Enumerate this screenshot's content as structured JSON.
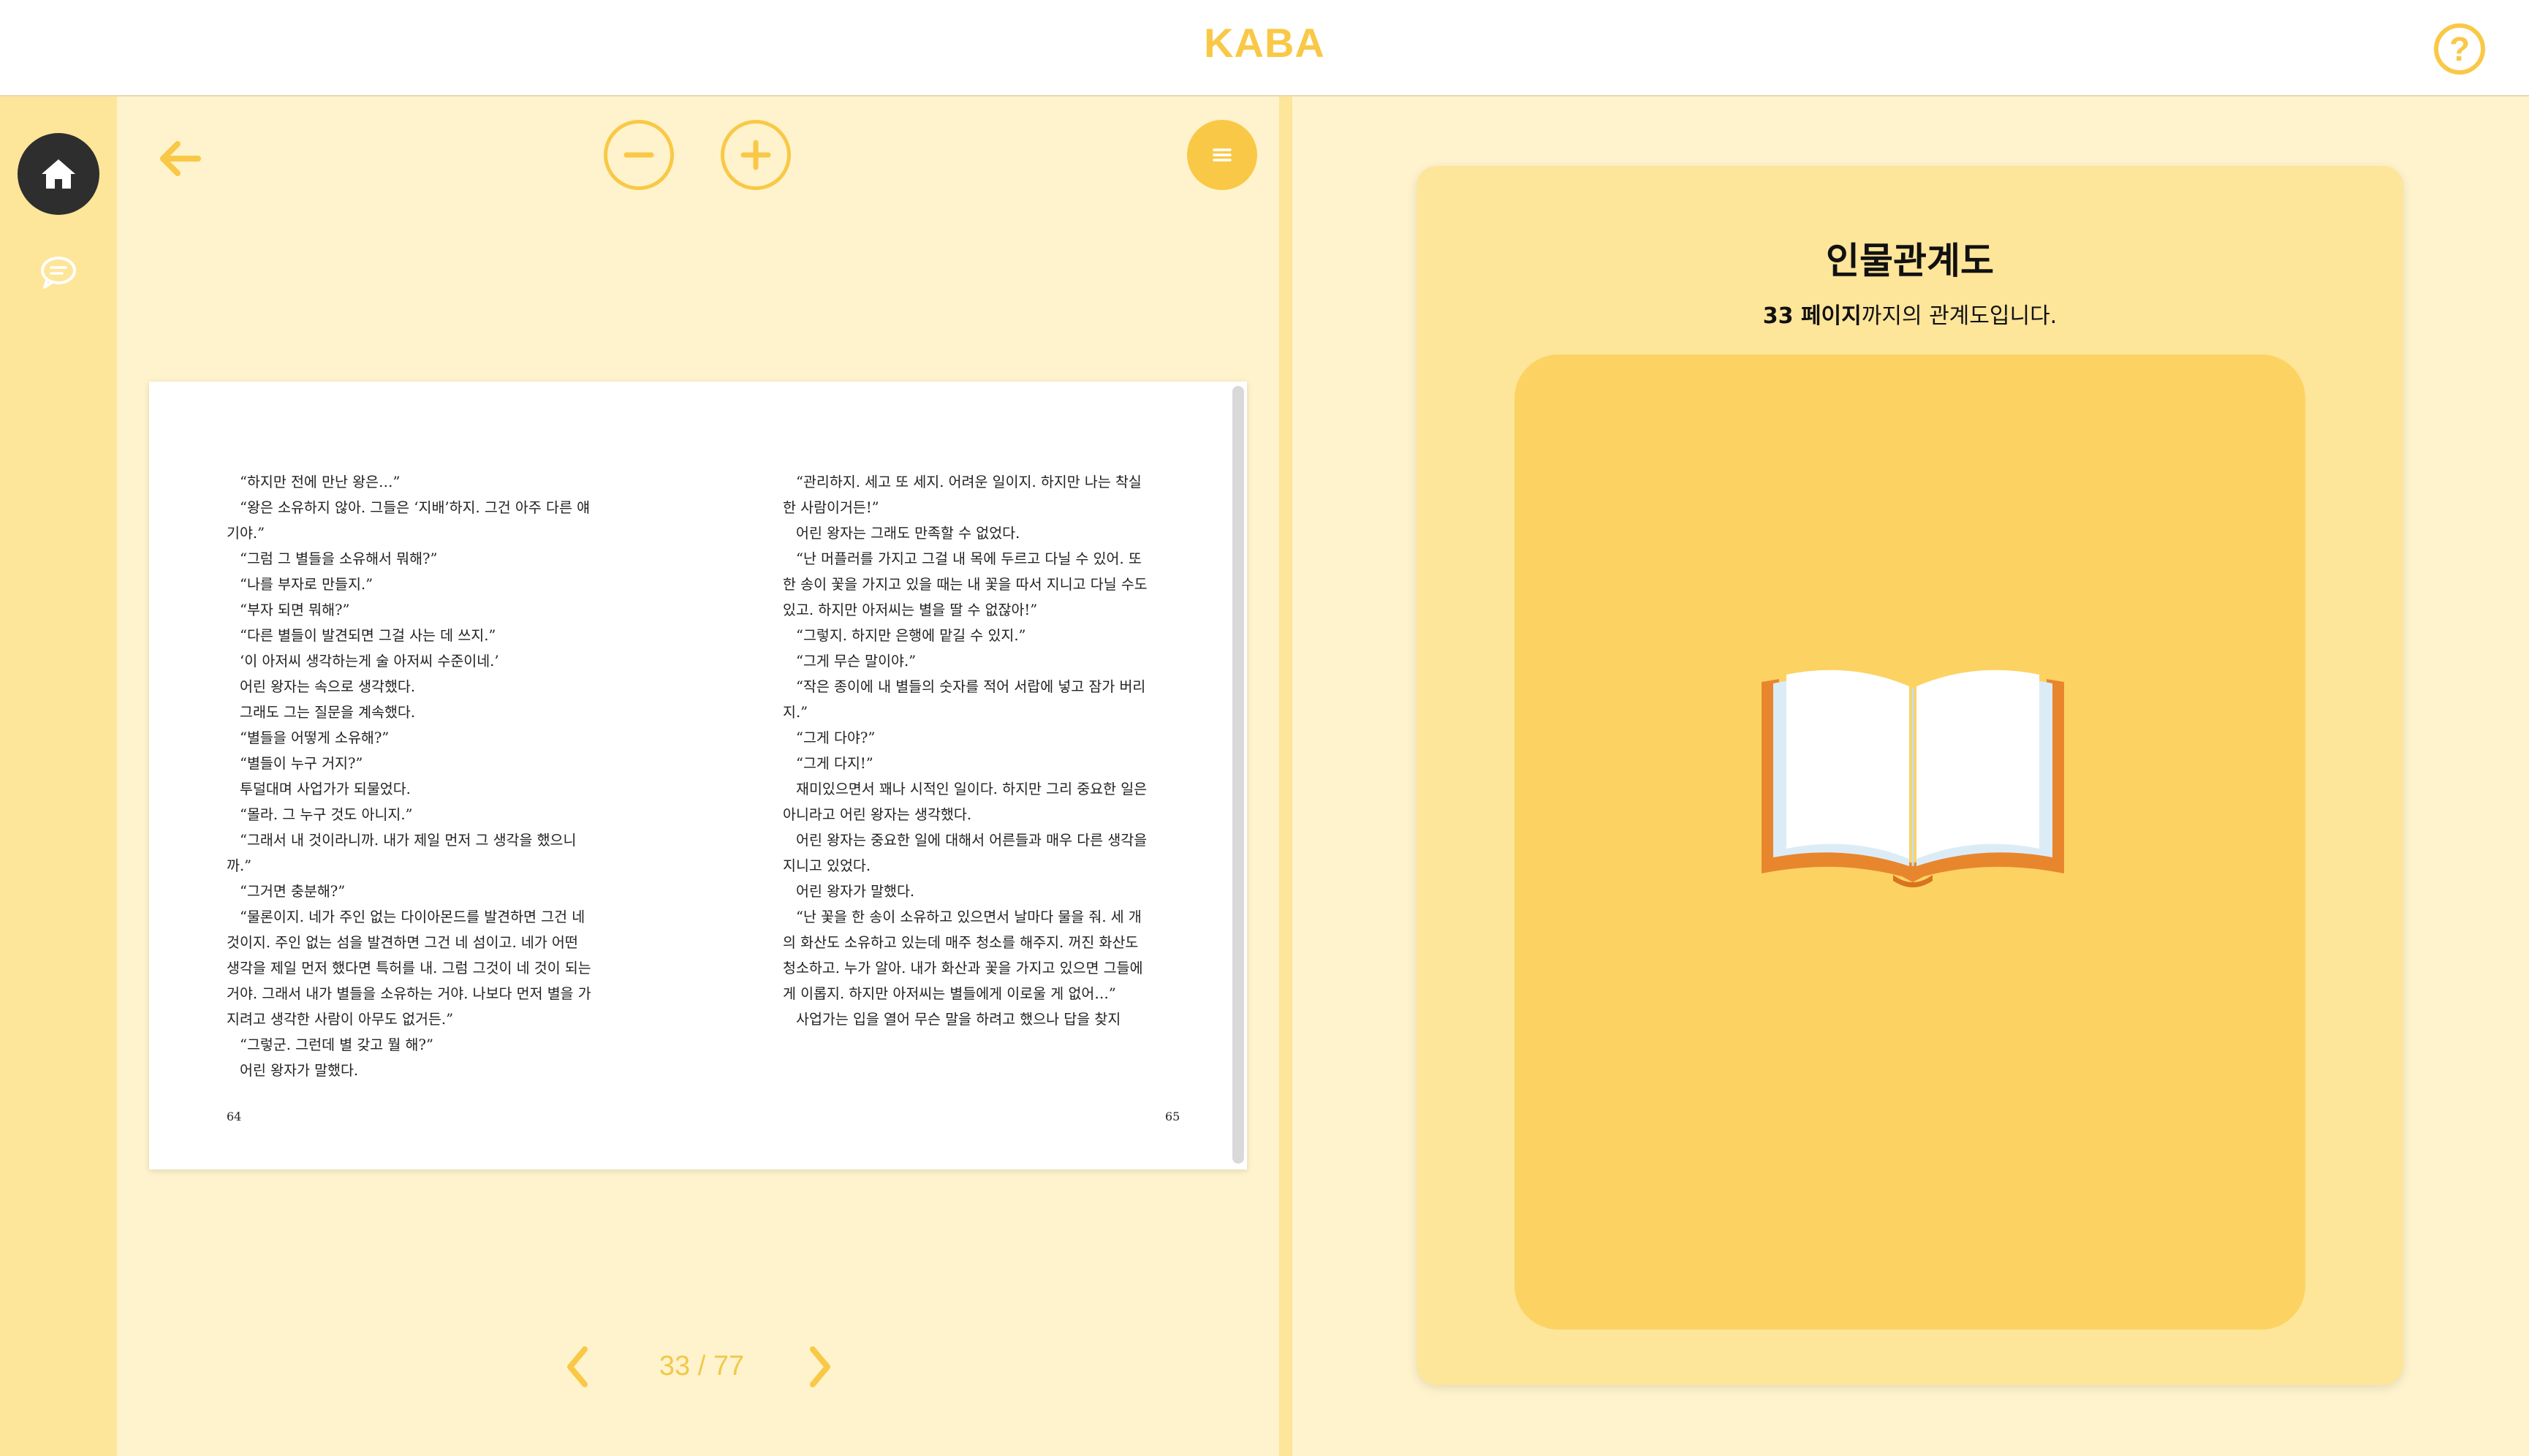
{
  "app": {
    "brand": "KABA",
    "help_icon": "question-circle-icon",
    "help_label": "?"
  },
  "sidebar": {
    "items": [
      {
        "icon": "home-icon",
        "active": true
      },
      {
        "icon": "chat-icon",
        "active": false
      }
    ]
  },
  "toolbar": {
    "back_icon": "arrow-left-icon",
    "zoom_out_icon": "minus-icon",
    "zoom_in_icon": "plus-icon",
    "menu_icon": "menu-icon"
  },
  "book": {
    "left_page": {
      "number": "64",
      "lines": [
        "“하지만 전에 만난 왕은…”",
        "“왕은 소유하지 않아. 그들은 ‘지배’하지. 그건 아주 다른 얘기야.”",
        "“그럼 그 별들을 소유해서 뭐해?”",
        "“나를 부자로 만들지.”",
        "“부자 되면 뭐해?”",
        "“다른 별들이 발견되면 그걸 사는 데 쓰지.”",
        "‘이 아저씨 생각하는게 술 아저씨 수준이네.’",
        "어린 왕자는 속으로 생각했다.",
        "그래도 그는 질문을 계속했다.",
        "“별들을 어떻게 소유해?”",
        "“별들이 누구 거지?”",
        "투덜대며 사업가가 되물었다.",
        "“몰라. 그 누구 것도 아니지.”",
        "“그래서 내 것이라니까. 내가 제일 먼저 그 생각을 했으니까.”",
        "“그거면 충분해?”",
        "“물론이지. 네가 주인 없는 다이아몬드를 발견하면 그건 네 것이지. 주인 없는 섬을 발견하면 그건 네 섬이고. 네가 어떤 생각을 제일 먼저 했다면 특허를 내. 그럼 그것이 네 것이 되는 거야. 그래서 내가 별들을 소유하는 거야. 나보다 먼저 별을 가지려고 생각한 사람이 아무도 없거든.”",
        "“그렇군. 그런데 별 갖고 뭘 해?”",
        "어린 왕자가 말했다."
      ]
    },
    "right_page": {
      "number": "65",
      "lines": [
        "“관리하지. 세고 또 세지. 어려운 일이지. 하지만 나는 착실한 사람이거든!”",
        "어린 왕자는 그래도 만족할 수 없었다.",
        "“난 머플러를 가지고 그걸 내 목에 두르고 다닐 수 있어. 또 한 송이 꽃을 가지고 있을 때는 내 꽃을 따서 지니고 다닐 수도 있고. 하지만 아저씨는 별을 딸 수 없잖아!”",
        "“그렇지. 하지만 은행에 맡길 수 있지.”",
        "“그게 무슨 말이야.”",
        "“작은 종이에 내 별들의 숫자를 적어 서랍에 넣고 잠가 버리지.”",
        "“그게 다야?”",
        "“그게 다지!”",
        "재미있으면서 꽤나 시적인 일이다. 하지만 그리 중요한 일은 아니라고 어린 왕자는 생각했다.",
        "어린 왕자는 중요한 일에 대해서 어른들과 매우 다른 생각을 지니고 있었다.",
        "어린 왕자가 말했다.",
        "“난 꽃을 한 송이 소유하고 있으면서 날마다 물을 줘. 세 개의 화산도 소유하고 있는데 매주 청소를 해주지. 꺼진 화산도 청소하고. 누가 알아. 내가 화산과 꽃을 가지고 있으면 그들에게 이롭지. 하지만 아저씨는 별들에게 이로울 게 없어…”",
        "사업가는 입을 열어 무슨 말을 하려고 했으나 답을 찾지"
      ]
    }
  },
  "pager": {
    "text": "33 / 77",
    "current": 33,
    "total": 77,
    "prev_icon": "chevron-left-icon",
    "next_icon": "chevron-right-icon"
  },
  "relation": {
    "title": "인물관계도",
    "subtitle_bold": "33 페이지",
    "subtitle_rest": "까지의 관계도입니다.",
    "illustration": "open-book-icon"
  },
  "colors": {
    "accent": "#f9c846",
    "background": "#fef3cc",
    "sidebar": "#fde59a",
    "card": "#fde59a",
    "card_inner": "#fcd362",
    "home_active": "#2e2e2e"
  }
}
